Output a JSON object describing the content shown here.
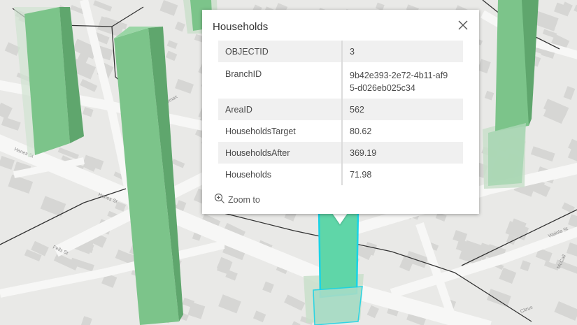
{
  "popup": {
    "title": "Households",
    "close_icon": "close-icon",
    "rows": [
      {
        "key": "OBJECTID",
        "value": "3"
      },
      {
        "key": "BranchID",
        "value": "9b42e393-2e72-4b11-af95-d026eb025c34"
      },
      {
        "key": "AreaID",
        "value": "562"
      },
      {
        "key": "HouseholdsTarget",
        "value": "80.62"
      },
      {
        "key": "HouseholdsAfter",
        "value": "369.19"
      },
      {
        "key": "Households",
        "value": "71.98"
      }
    ],
    "zoom_to_label": "Zoom to",
    "zoom_icon": "zoom-in-icon"
  },
  "map": {
    "street_labels": [
      "Hanes St",
      "Hanes St",
      "Fells St",
      "Walola St",
      "McCall",
      "Citrus",
      "Lomax"
    ],
    "colors": {
      "background": "#e9e9e7",
      "building": "#d6d6d4",
      "road": "#f7f7f6",
      "extrusion_green": "#7cc48a",
      "extrusion_selected": "#5fd6a8",
      "selection_outline": "#19d3e6"
    }
  }
}
